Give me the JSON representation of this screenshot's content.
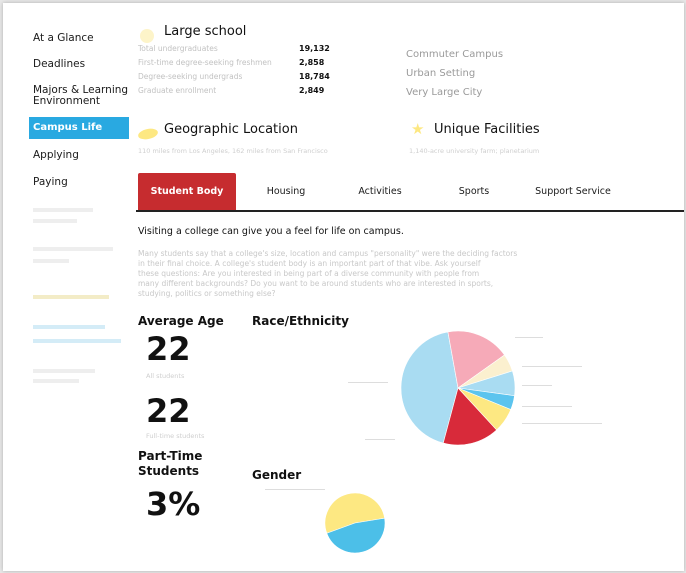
{
  "sidebar": {
    "items": [
      {
        "label": "At a Glance"
      },
      {
        "label": "Deadlines"
      },
      {
        "label": "Majors & Learning Environment"
      },
      {
        "label": "Campus Life"
      },
      {
        "label": "Applying"
      },
      {
        "label": "Paying"
      }
    ]
  },
  "size_section": {
    "title": "Large school",
    "stats": [
      {
        "label": "Total undergraduates",
        "value": "19,132"
      },
      {
        "label": "First-time degree-seeking freshmen",
        "value": "2,858"
      },
      {
        "label": "Degree-seeking undergrads",
        "value": "18,784"
      },
      {
        "label": "Graduate enrollment",
        "value": "2,849"
      }
    ],
    "facts": [
      "Commuter Campus",
      "Urban Setting",
      "Very Large City"
    ]
  },
  "geo": {
    "title": "Geographic Location",
    "text": "110 miles from Los Angeles, 162 miles from San Francisco"
  },
  "facilities": {
    "title": "Unique Facilities",
    "text": "1,140-acre university farm; planetarium"
  },
  "tabs": [
    {
      "label": "Student Body",
      "active": true
    },
    {
      "label": "Housing"
    },
    {
      "label": "Activities"
    },
    {
      "label": "Sports"
    },
    {
      "label": "Support Service"
    }
  ],
  "intro": {
    "heading": "Visiting a college can give you a feel for life on campus.",
    "lines": [
      "Many students say that a college's size, location and campus \"personality\" were the deciding factors",
      "in their final choice. A college's student body is an important part of that vibe. Ask yourself",
      "these questions: Are you interested in being part of a diverse community with people from",
      "many different backgrounds? Do you want to be around students who are interested in sports,",
      "studying, politics or something else?"
    ]
  },
  "age": {
    "title": "Average Age",
    "all_value": "22",
    "all_label": "All students",
    "ft_value": "22",
    "ft_label": "Full-time students"
  },
  "parttime": {
    "title": "Part-Time Students",
    "value": "3%"
  },
  "race": {
    "title": "Race/Ethnicity"
  },
  "gender": {
    "title": "Gender"
  },
  "colors": {
    "accent_red": "#c62c2f",
    "active_blue": "#29a9e1",
    "pie_light_blue": "#a9dcf2",
    "pie_pink": "#f6aab8",
    "pie_cream": "#fbf0cf",
    "pie_blue": "#5cc4ee",
    "pie_yellow": "#fde882",
    "pie_red": "#d82a3a",
    "gender_yellow": "#fde882",
    "gender_blue": "#4cbfe8"
  },
  "chart_data": [
    {
      "type": "pie",
      "title": "Race/Ethnicity",
      "values": [
        43,
        18,
        5,
        7,
        4,
        7,
        16
      ],
      "colors": [
        "#a9dcf2",
        "#f6aab8",
        "#fbf0cf",
        "#a9dcf2",
        "#5cc4ee",
        "#fde882",
        "#d82a3a"
      ]
    },
    {
      "type": "pie",
      "title": "Gender",
      "values": [
        53,
        47
      ],
      "colors": [
        "#fde882",
        "#4cbfe8"
      ]
    }
  ]
}
